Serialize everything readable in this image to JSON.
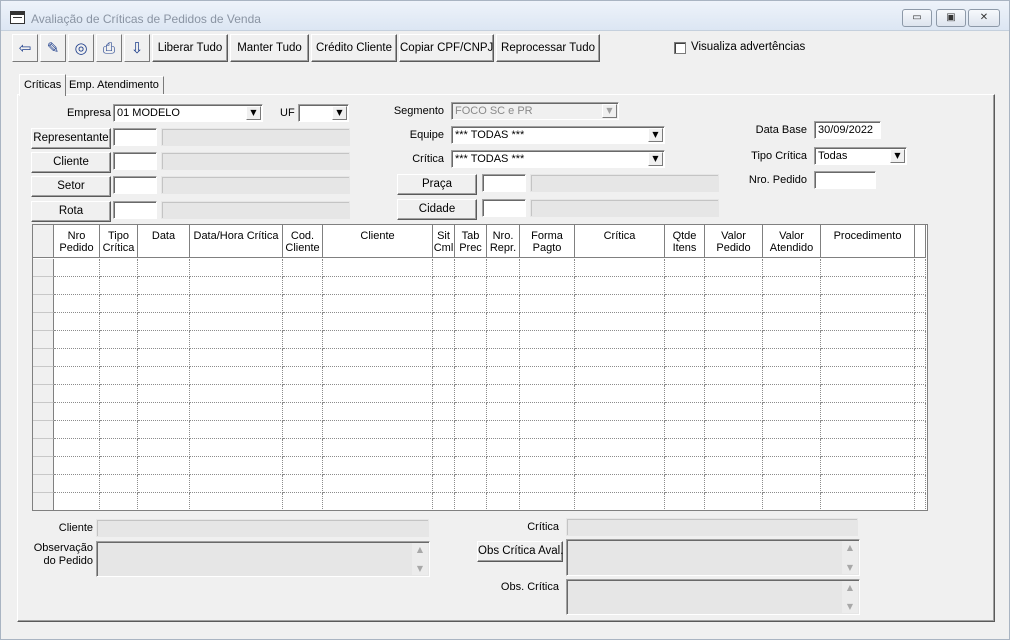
{
  "window": {
    "title": "Avaliação de Críticas de Pedidos de Venda",
    "minimize_glyph": "▭",
    "maximize_glyph": "▣",
    "close_glyph": "✕"
  },
  "toolbar": {
    "icons": [
      {
        "name": "exit-icon",
        "glyph": "⇦"
      },
      {
        "name": "eraser-icon",
        "glyph": "✎"
      },
      {
        "name": "binoculars-icon",
        "glyph": "◎"
      },
      {
        "name": "printer-icon",
        "glyph": "⎙"
      },
      {
        "name": "export-icon",
        "glyph": "⇩"
      }
    ],
    "buttons": {
      "liberar_tudo": "Liberar Tudo",
      "manter_tudo": "Manter Tudo",
      "credito_cliente": "Crédito Cliente",
      "copiar_cpf": "Copiar  CPF/CNPJ",
      "reprocessar_tudo": "Reprocessar Tudo"
    },
    "visualiza_label": "Visualiza advertências",
    "visualiza_checked": false
  },
  "tabs": [
    "Críticas",
    "Emp. Atendimento"
  ],
  "active_tab": 0,
  "filters": {
    "empresa_label": "Empresa",
    "empresa_value": "01 MODELO",
    "uf_label": "UF",
    "uf_value": "",
    "representante_btn": "Representante",
    "cliente_btn": "Cliente",
    "setor_btn": "Setor",
    "rota_btn": "Rota",
    "segmento_label": "Segmento",
    "segmento_value": "FOCO SC e PR",
    "equipe_label": "Equipe",
    "equipe_value": "*** TODAS ***",
    "critica_label": "Crítica",
    "critica_value": "*** TODAS ***",
    "praca_btn": "Praça",
    "cidade_btn": "Cidade",
    "data_base_label": "Data Base",
    "data_base_value": "30/09/2022",
    "tipo_critica_label": "Tipo Crítica",
    "tipo_critica_value": "Todas",
    "nro_pedido_label": "Nro. Pedido",
    "nro_pedido_value": ""
  },
  "grid": {
    "columns": [
      {
        "key": "sel",
        "label": ""
      },
      {
        "key": "nro_pedido",
        "label": "Nro\nPedido"
      },
      {
        "key": "tipo_critica",
        "label": "Tipo\nCrítica"
      },
      {
        "key": "data",
        "label": "Data"
      },
      {
        "key": "data_hora_critica",
        "label": "Data/Hora Crítica"
      },
      {
        "key": "cod_cliente",
        "label": "Cod.\nCliente"
      },
      {
        "key": "cliente",
        "label": "Cliente"
      },
      {
        "key": "sit_cml",
        "label": "Sit\nCml"
      },
      {
        "key": "tab_prec",
        "label": "Tab\nPrec"
      },
      {
        "key": "nro_repr",
        "label": "Nro.\nRepr."
      },
      {
        "key": "forma_pagto",
        "label": "Forma\nPagto"
      },
      {
        "key": "critica",
        "label": "Crítica"
      },
      {
        "key": "qtde_itens",
        "label": "Qtde\nItens"
      },
      {
        "key": "valor_pedido",
        "label": "Valor\nPedido"
      },
      {
        "key": "valor_atendido",
        "label": "Valor\nAtendido"
      },
      {
        "key": "procedimento",
        "label": "Procedimento"
      },
      {
        "key": "extra",
        "label": ""
      }
    ],
    "empty_rows": 14
  },
  "bottom": {
    "cliente_label": "Cliente",
    "cliente_value": "",
    "observacao_label": "Observação\ndo Pedido",
    "observacao_value": "",
    "critica_label": "Crítica",
    "critica_value": "",
    "obs_critica_aval_btn": "Obs Crítica Aval.",
    "obs_critica_aval_value": "",
    "obs_critica_label": "Obs. Crítica",
    "obs_critica_value": ""
  }
}
